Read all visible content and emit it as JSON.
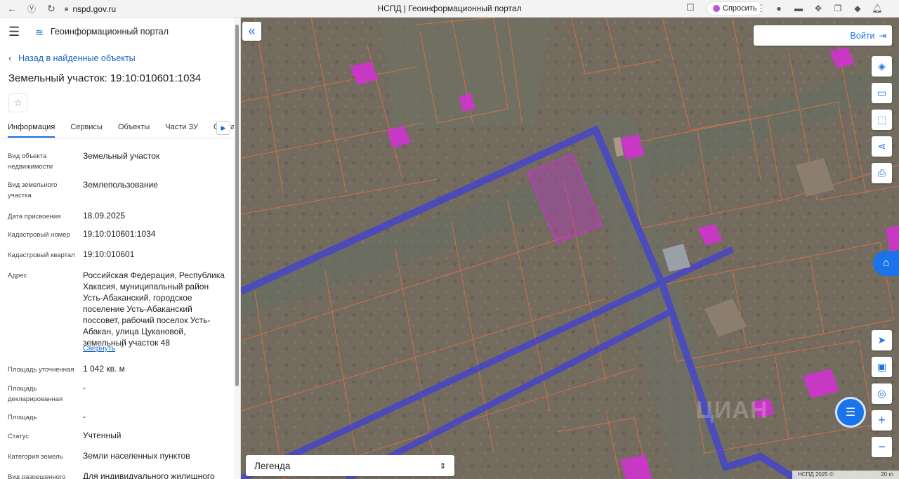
{
  "browser": {
    "url": "nspd.gov.ru",
    "tab_title": "НСПД | Геоинформационный портал",
    "ask_label": "Спросить"
  },
  "panel": {
    "portal_title": "Геоинформационный портал",
    "back_label": "Назад в найденные объекты",
    "title": "Земельный участок: 19:10:010601:1034",
    "tabs": [
      "Информация",
      "Сервисы",
      "Объекты",
      "Части ЗУ",
      "Соста"
    ],
    "active_tab": "Информация",
    "props": [
      {
        "label": "Вид объекта недвижимости",
        "value": "Земельный участок"
      },
      {
        "label": "Вид земельного участка",
        "value": "Землепользование"
      },
      {
        "label": "Дата присвоения",
        "value": "18.09.2025"
      },
      {
        "label": "Кадастровый номер",
        "value": "19:10:010601:1034"
      },
      {
        "label": "Кадастровый квартал",
        "value": "19:10:010601"
      },
      {
        "label": "Адрес",
        "value": "Российская Федерация, Республика Хакасия, муниципальный район Усть-Абаканский, городское поселение Усть-Абаканский поссовет, рабочий поселок Усть-Абакан, улица Цукановой, земельный участок 48"
      },
      {
        "label": "Площадь уточненная",
        "value": "1 042 кв. м"
      },
      {
        "label": "Площадь декларированная",
        "value": "-"
      },
      {
        "label": "Площадь",
        "value": "-"
      },
      {
        "label": "Статус",
        "value": "Учтенный"
      },
      {
        "label": "Категория земель",
        "value": "Земли населенных пунктов"
      },
      {
        "label": "Вид разрешенного",
        "value": "Для индивидуального жилищного"
      }
    ],
    "collapse_label": "Свернуть"
  },
  "map": {
    "login_label": "Войти",
    "legend_label": "Легенда",
    "scale_left": "НСПД 2025 ©",
    "scale_right": "20 m",
    "watermark": "ЦИАН",
    "colors": {
      "road": "#3f3fd6",
      "parcel_border": "#e0704a",
      "building": "#d62fd6",
      "accent": "#1a73e8"
    },
    "icons": [
      "layers-icon",
      "ruler-icon",
      "select-area-icon",
      "share-icon",
      "print-icon",
      "locate-icon",
      "minimap-icon",
      "geotag-icon",
      "zoom-in-icon",
      "zoom-out-icon"
    ]
  }
}
